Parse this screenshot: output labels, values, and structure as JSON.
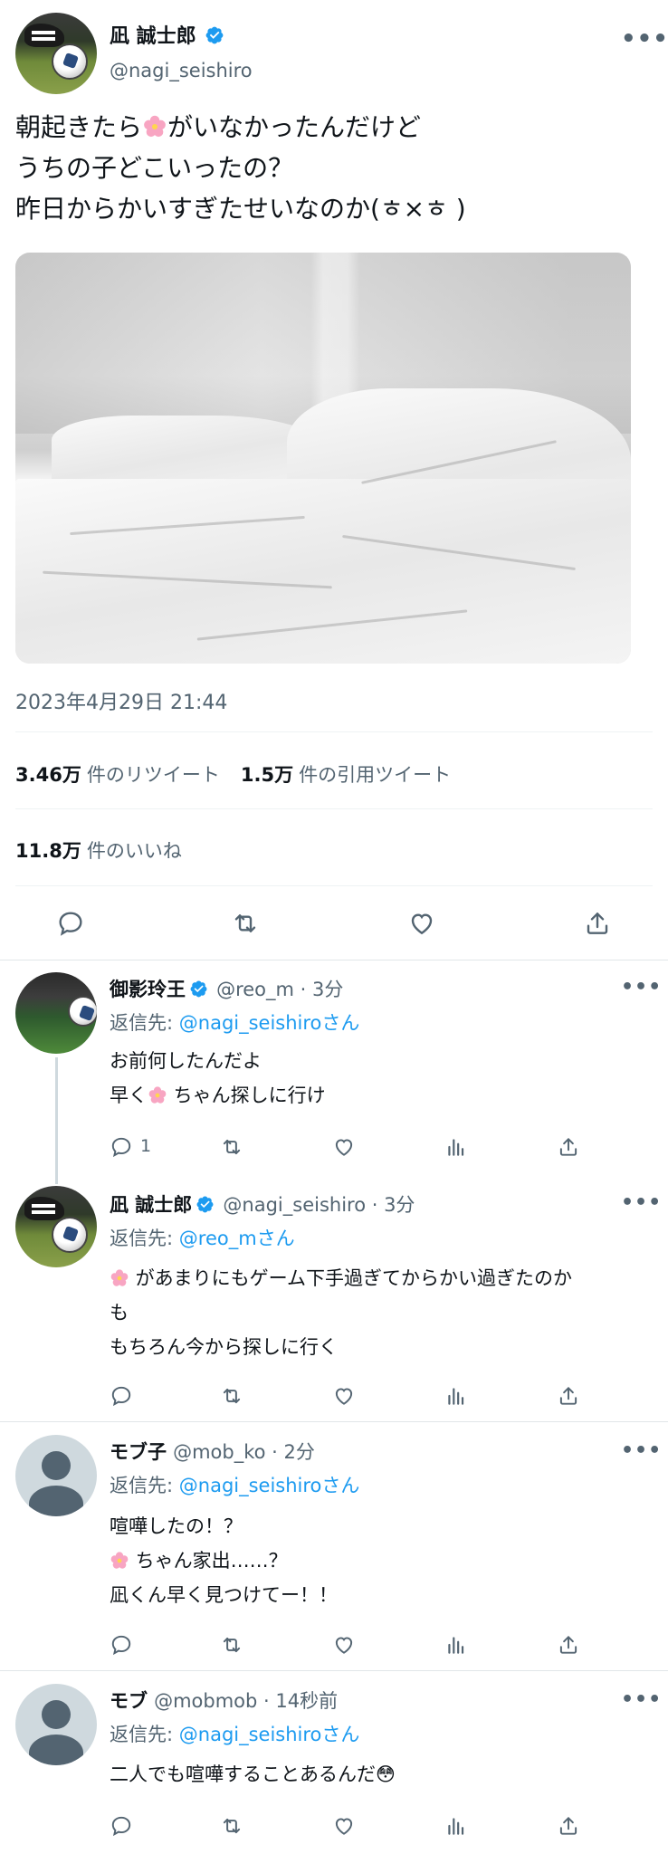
{
  "main_tweet": {
    "author_name": "凪 誠士郎",
    "author_handle": "@nagi_seishiro",
    "more_label": "•••",
    "text_lines": [
      {
        "before": "朝起きたら",
        "emoji": true,
        "after": "がいなかったんだけど"
      },
      {
        "before": "うちの子どこいったの？",
        "emoji": false,
        "after": ""
      },
      {
        "before": "昨日からかいすぎたせいなのか(ㅎ×ㅎ )",
        "emoji": false,
        "after": ""
      }
    ],
    "timestamp": "2023年4月29日 21:44",
    "retweets_count": "3.46万",
    "retweets_label": "件のリツイート",
    "quotes_count": "1.5万",
    "quotes_label": "件の引用ツイート",
    "likes_count": "11.8万",
    "likes_label": "件のいいね"
  },
  "icons": {
    "verified": "verified-badge-icon",
    "flower": "cherry-blossom-emoji",
    "reply": "reply-icon",
    "retweet": "retweet-icon",
    "like": "heart-icon",
    "views": "views-icon",
    "share": "share-icon"
  },
  "colors": {
    "accent": "#1d9bf0",
    "text": "#0f1419",
    "muted": "#536471",
    "flower": "#f48fb1"
  },
  "replies": [
    {
      "name": "御影玲王",
      "verified": true,
      "handle_time": "@reo_m · 3分",
      "reply_to_label": "返信先: ",
      "reply_to_target": "@nagi_seishiroさん",
      "lines": [
        {
          "before": "お前何したんだよ",
          "emoji": false,
          "after": ""
        },
        {
          "before": "早く",
          "emoji": true,
          "after": " ちゃん探しに行け"
        }
      ],
      "reply_count": "1"
    },
    {
      "name": "凪 誠士郎",
      "verified": true,
      "handle_time": "@nagi_seishiro · 3分",
      "reply_to_label": "返信先: ",
      "reply_to_target": "@reo_mさん",
      "lines": [
        {
          "before": "",
          "emoji": true,
          "after": " があまりにもゲーム下手過ぎてからかい過ぎたのか"
        },
        {
          "before": "も",
          "emoji": false,
          "after": ""
        },
        {
          "before": "もちろん今から探しに行く",
          "emoji": false,
          "after": ""
        }
      ],
      "reply_count": ""
    },
    {
      "name": "モブ子",
      "verified": false,
      "handle_time": "@mob_ko · 2分",
      "reply_to_label": "返信先: ",
      "reply_to_target": "@nagi_seishiroさん",
      "lines": [
        {
          "before": "喧嘩したの！？",
          "emoji": false,
          "after": ""
        },
        {
          "before": "",
          "emoji": true,
          "after": " ちゃん家出……？"
        },
        {
          "before": "凪くん早く見つけてー！！",
          "emoji": false,
          "after": ""
        }
      ],
      "reply_count": ""
    },
    {
      "name": "モブ",
      "verified": false,
      "handle_time": "@mobmob · 14秒前",
      "reply_to_label": "返信先: ",
      "reply_to_target": "@nagi_seishiroさん",
      "lines": [
        {
          "before": "二人でも喧嘩することあるんだ😳",
          "emoji": false,
          "after": ""
        }
      ],
      "reply_count": ""
    }
  ]
}
